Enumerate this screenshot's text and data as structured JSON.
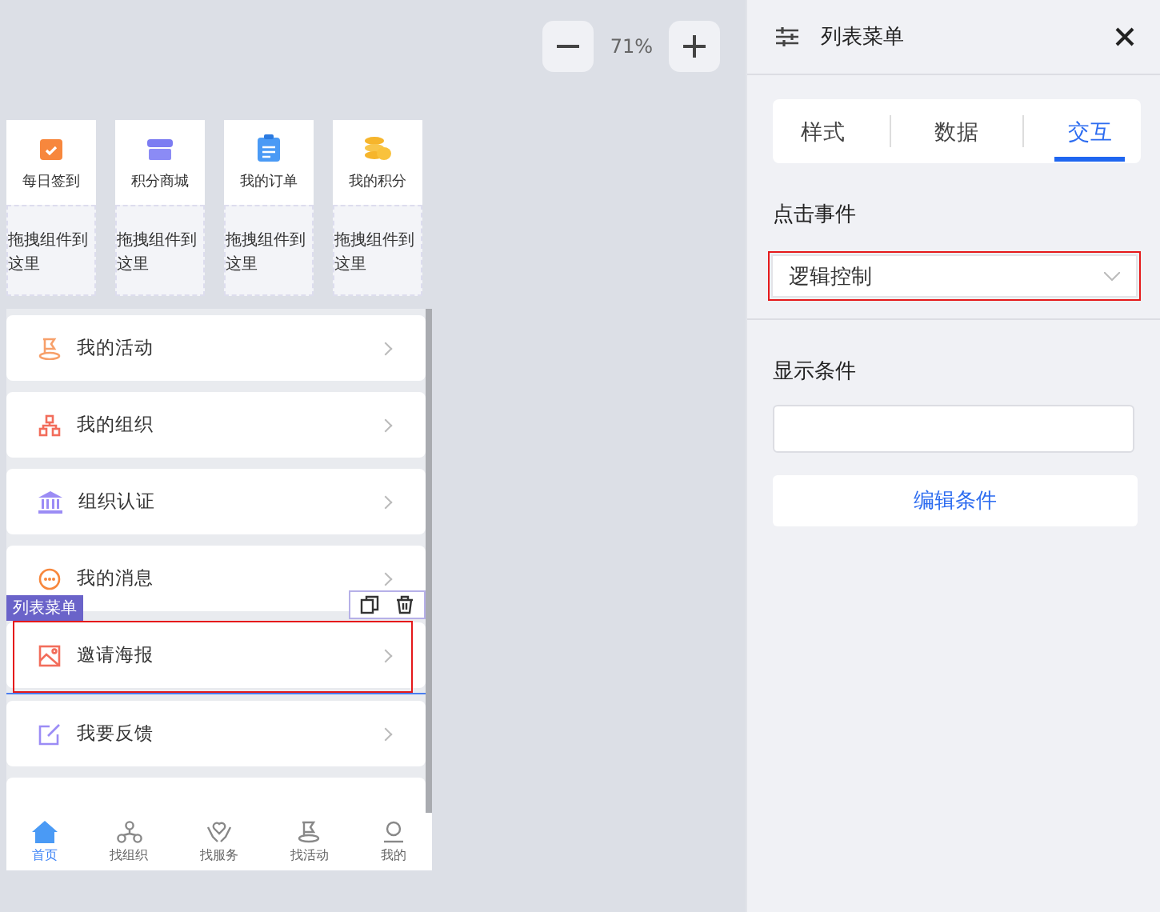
{
  "zoom": {
    "value": "71%"
  },
  "grid_items": [
    {
      "label": "每日签到",
      "placeholder": "拖拽组件到这里"
    },
    {
      "label": "积分商城",
      "placeholder": "拖拽组件到这里"
    },
    {
      "label": "我的订单",
      "placeholder": "拖拽组件到这里"
    },
    {
      "label": "我的积分",
      "placeholder": "拖拽组件到这里"
    }
  ],
  "menu_items": [
    {
      "label": "我的活动",
      "selected": false,
      "highlighted": false
    },
    {
      "label": "我的组织",
      "selected": false,
      "highlighted": false
    },
    {
      "label": "组织认证",
      "selected": false,
      "highlighted": false
    },
    {
      "label": "我的消息",
      "selected": false,
      "highlighted": false
    },
    {
      "label": "邀请海报",
      "selected": true,
      "highlighted": true
    },
    {
      "label": "我要反馈",
      "selected": false,
      "highlighted": false
    }
  ],
  "selection_tag": "列表菜单",
  "tab_bar": [
    {
      "label": "首页",
      "selected": true
    },
    {
      "label": "找组织",
      "selected": false
    },
    {
      "label": "找服务",
      "selected": false
    },
    {
      "label": "找活动",
      "selected": false
    },
    {
      "label": "我的",
      "selected": false
    }
  ],
  "panel": {
    "title": "列表菜单",
    "tabs": [
      {
        "label": "样式",
        "selected": false
      },
      {
        "label": "数据",
        "selected": false
      },
      {
        "label": "交互",
        "selected": true
      }
    ],
    "click_event": {
      "label": "点击事件",
      "value": "逻辑控制",
      "highlighted": true
    },
    "display_condition": {
      "label": "显示条件",
      "button": "编辑条件"
    }
  }
}
